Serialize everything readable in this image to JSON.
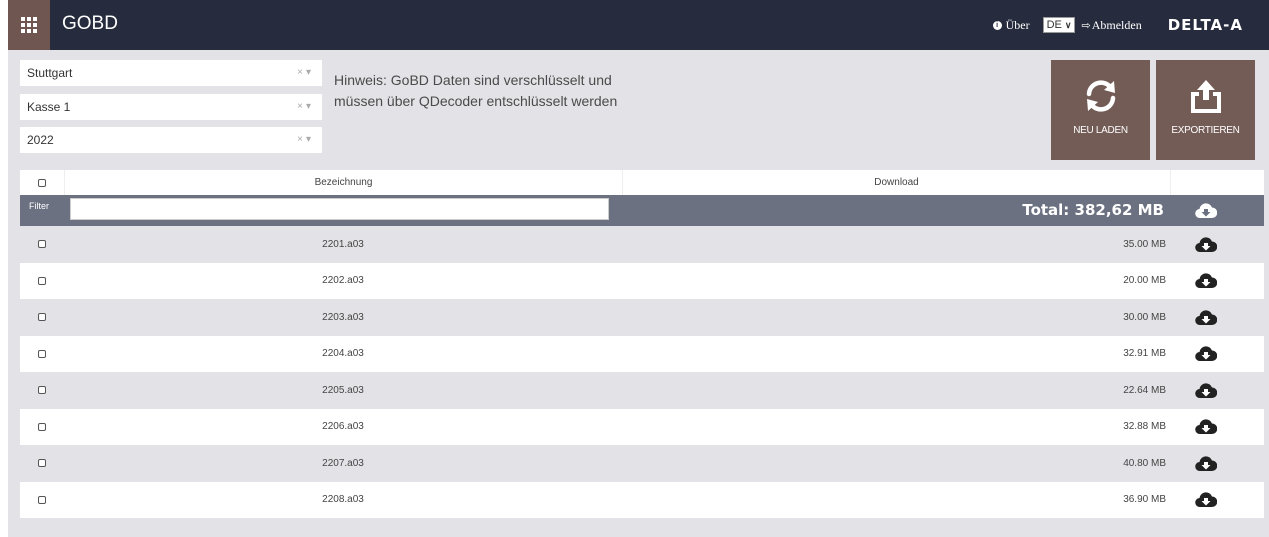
{
  "header": {
    "title": "GOBD",
    "about_label": "Über",
    "language": "DE",
    "logout_label": "Abmelden",
    "brand": "DELTA-A"
  },
  "filters": {
    "location": "Stuttgart",
    "register": "Kasse 1",
    "year": "2022"
  },
  "hint": "Hinweis: GoBD Daten sind verschlüsselt und müssen über QDecoder entschlüsselt werden",
  "actions": {
    "reload_label": "NEU LADEN",
    "export_label": "EXPORTIEREN"
  },
  "table": {
    "col_name": "Bezeichnung",
    "col_download": "Download",
    "filter_label": "Filter",
    "filter_value": "",
    "total": "Total: 382,62 MB",
    "rows": [
      {
        "name": "2201.a03",
        "size": "35.00 MB"
      },
      {
        "name": "2202.a03",
        "size": "20.00 MB"
      },
      {
        "name": "2203.a03",
        "size": "30.00 MB"
      },
      {
        "name": "2204.a03",
        "size": "32.91 MB"
      },
      {
        "name": "2205.a03",
        "size": "22.64 MB"
      },
      {
        "name": "2206.a03",
        "size": "32.88 MB"
      },
      {
        "name": "2207.a03",
        "size": "40.80 MB"
      },
      {
        "name": "2208.a03",
        "size": "36.90 MB"
      }
    ]
  },
  "colors": {
    "header_bg": "#262c3d",
    "accent": "#735b56",
    "filter_bar": "#6b7181"
  }
}
